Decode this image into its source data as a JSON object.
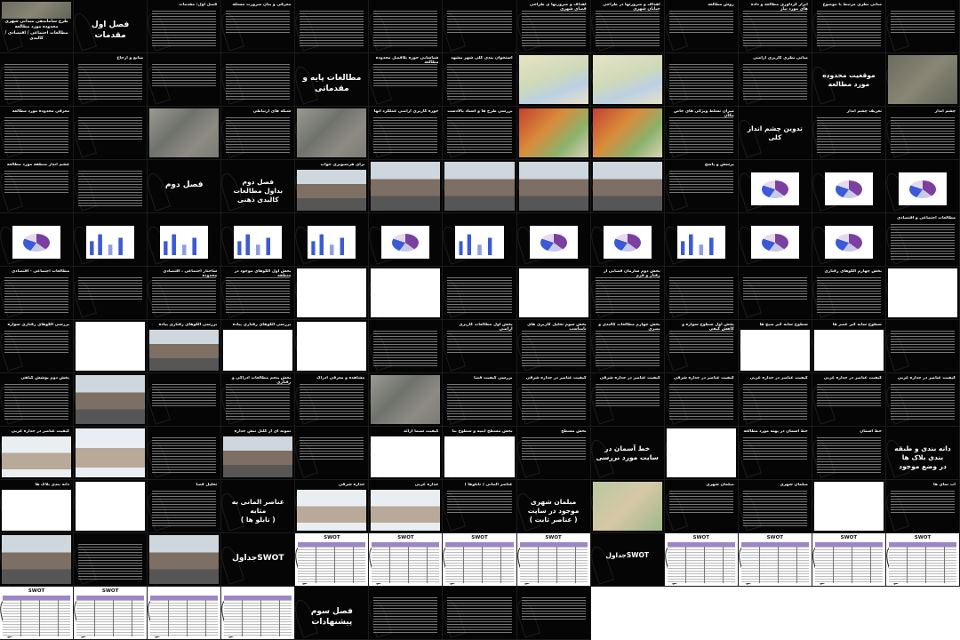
{
  "slides": [
    {
      "kind": "title-photo",
      "title": "طرح ساماندهی مبدانی شهری\nمحدوده مورد مطالعه\nمطالعات اجتماعی / اقتصادی / کالبدی"
    },
    {
      "kind": "big",
      "text": "فصل اول\nمقدمات"
    },
    {
      "kind": "text",
      "title": "فصل اول: مقدمات"
    },
    {
      "kind": "text",
      "title": "معرفی و بیان ضرورت مسئله"
    },
    {
      "kind": "text",
      "title": ""
    },
    {
      "kind": "text",
      "title": ""
    },
    {
      "kind": "text",
      "title": ""
    },
    {
      "kind": "text",
      "title": "اهداف و ضرورتها ی طراحی فضای شهری"
    },
    {
      "kind": "text",
      "title": "اهداف و ضرورتها در طراحی خیابان شهری"
    },
    {
      "kind": "text",
      "title": "روش مطالعه"
    },
    {
      "kind": "text",
      "title": "ابزار گردآوری مطالعه و داده های مورد نیاز"
    },
    {
      "kind": "text",
      "title": "مبانی نظری مرتبط با موضوع"
    },
    {
      "kind": "text",
      "title": ""
    },
    {
      "kind": "text",
      "title": ""
    },
    {
      "kind": "text",
      "title": "منابع و ارجاع"
    },
    {
      "kind": "text",
      "title": ""
    },
    {
      "kind": "text",
      "title": ""
    },
    {
      "kind": "big",
      "text": "مطالعات پایه و مقدماتی"
    },
    {
      "kind": "text",
      "title": "شناسایی حوزه بلافصل محدوده مطالعه"
    },
    {
      "kind": "text",
      "title": "استخوان بندی کلی شهر مشهد"
    },
    {
      "kind": "img",
      "img": "map2",
      "title": ""
    },
    {
      "kind": "img",
      "img": "map2",
      "title": ""
    },
    {
      "kind": "text",
      "title": ""
    },
    {
      "kind": "text",
      "title": "مبانی نظری کاربری اراضی"
    },
    {
      "kind": "big",
      "text": "موقعیت محدوده مورد مطالعه"
    },
    {
      "kind": "img",
      "img": "aerial",
      "title": ""
    },
    {
      "kind": "text",
      "title": "معرفی محدوده مورد مطالعه"
    },
    {
      "kind": "text",
      "title": ""
    },
    {
      "kind": "img",
      "img": "map",
      "title": ""
    },
    {
      "kind": "text",
      "title": "شبکه های ارتباطی"
    },
    {
      "kind": "img",
      "img": "map",
      "title": ""
    },
    {
      "kind": "text",
      "title": "حوزه کاربری اراضی عملکرد آنها"
    },
    {
      "kind": "text",
      "title": "بررسی طرح ها و اسناد بالادست"
    },
    {
      "kind": "img",
      "img": "red",
      "title": ""
    },
    {
      "kind": "img",
      "img": "red",
      "title": ""
    },
    {
      "kind": "text",
      "title": "میزان تسلط ویژگی های خاص مکان"
    },
    {
      "kind": "big",
      "text": "تدوین چشم انداز کلی"
    },
    {
      "kind": "text",
      "title": "تعریف چشم انداز"
    },
    {
      "kind": "text",
      "title": "چشم انداز"
    },
    {
      "kind": "text",
      "title": "چشم انداز منطقه مورد مطالعه"
    },
    {
      "kind": "text",
      "title": ""
    },
    {
      "kind": "big",
      "text": "فصل دوم"
    },
    {
      "kind": "big",
      "text": "فصل دوم\nبداول مطالعات کالبدی ذهنی"
    },
    {
      "kind": "img",
      "img": "street",
      "title": "برای هرتصویری جواب"
    },
    {
      "kind": "img",
      "img": "street",
      "title": ""
    },
    {
      "kind": "img",
      "img": "street",
      "title": ""
    },
    {
      "kind": "img",
      "img": "street",
      "title": ""
    },
    {
      "kind": "img",
      "img": "street",
      "title": ""
    },
    {
      "kind": "text",
      "title": "پرسش و پاسخ"
    },
    {
      "kind": "chart",
      "chart": "pie",
      "title": ""
    },
    {
      "kind": "chart",
      "chart": "pie",
      "title": ""
    },
    {
      "kind": "chart",
      "chart": "pie",
      "title": ""
    },
    {
      "kind": "chart",
      "chart": "pie",
      "title": ""
    },
    {
      "kind": "chart",
      "chart": "bar",
      "title": ""
    },
    {
      "kind": "chart",
      "chart": "bar",
      "title": ""
    },
    {
      "kind": "chart",
      "chart": "bar",
      "title": ""
    },
    {
      "kind": "chart",
      "chart": "bar",
      "title": ""
    },
    {
      "kind": "chart",
      "chart": "pie",
      "title": ""
    },
    {
      "kind": "chart",
      "chart": "bar",
      "title": ""
    },
    {
      "kind": "chart",
      "chart": "pie",
      "title": ""
    },
    {
      "kind": "chart",
      "chart": "pie",
      "title": ""
    },
    {
      "kind": "chart",
      "chart": "bar",
      "title": ""
    },
    {
      "kind": "chart",
      "chart": "pie",
      "title": ""
    },
    {
      "kind": "chart",
      "chart": "pie",
      "title": ""
    },
    {
      "kind": "text",
      "title": "مطالعات اجتماعی و اقتصادی"
    },
    {
      "kind": "text",
      "title": "مطالعات اجتماعی - اقتصادی"
    },
    {
      "kind": "text",
      "title": ""
    },
    {
      "kind": "text",
      "title": "ساختار اجتماعی ، اقتصادی محدوده"
    },
    {
      "kind": "text",
      "title": "بخش اول الگوهای موجود در منطقه"
    },
    {
      "kind": "img",
      "img": "plan",
      "title": ""
    },
    {
      "kind": "img",
      "img": "plan",
      "title": ""
    },
    {
      "kind": "text",
      "title": ""
    },
    {
      "kind": "img",
      "img": "plan",
      "title": ""
    },
    {
      "kind": "text",
      "title": "بخش دوم سازمان فضایی از رفتار و فرم"
    },
    {
      "kind": "text",
      "title": ""
    },
    {
      "kind": "text",
      "title": ""
    },
    {
      "kind": "text",
      "title": "بخش چهارم الگوهای رفتاری"
    },
    {
      "kind": "img",
      "img": "plan",
      "title": ""
    },
    {
      "kind": "text",
      "title": "بررسی الگوهای رفتاری سواره"
    },
    {
      "kind": "img",
      "img": "plan",
      "title": ""
    },
    {
      "kind": "img",
      "img": "street",
      "title": "بررسی الگوهای رفتاری پیاده"
    },
    {
      "kind": "img",
      "img": "plan",
      "title": "بررسی الگوهای رفتاری پیاده"
    },
    {
      "kind": "img",
      "img": "plan",
      "title": ""
    },
    {
      "kind": "text",
      "title": ""
    },
    {
      "kind": "text",
      "title": "بخش اول مطالعات کاربری اراضی"
    },
    {
      "kind": "text",
      "title": "بخش سوم تحلیل کاربری های نامناسب"
    },
    {
      "kind": "text",
      "title": "بخش چهارم مطالعات کالبدی و بصری"
    },
    {
      "kind": "text",
      "title": "بخش اول سطوح سواره و کاهش کیفی"
    },
    {
      "kind": "img",
      "img": "plan",
      "title": "سطوح سایه گیر صبح ها"
    },
    {
      "kind": "img",
      "img": "plan",
      "title": "سطوح سایه گیر عصر ها"
    },
    {
      "kind": "text",
      "title": ""
    },
    {
      "kind": "text",
      "title": "بخش دوم پوشش گیاهی"
    },
    {
      "kind": "img",
      "img": "street",
      "title": ""
    },
    {
      "kind": "text",
      "title": ""
    },
    {
      "kind": "text",
      "title": "بخش پنجم مطالعات ادراکی و رفتاری"
    },
    {
      "kind": "text",
      "title": "مشاهده و معرفی ادراک"
    },
    {
      "kind": "img",
      "img": "map",
      "title": ""
    },
    {
      "kind": "text",
      "title": "بررسی کیفیت فضا"
    },
    {
      "kind": "text",
      "title": "کیفیت عناصر در جداره شرقی"
    },
    {
      "kind": "text",
      "title": "کیفیت عناصر در جداره شرقی"
    },
    {
      "kind": "text",
      "title": "کیفیت عناصر در جداره شرقی"
    },
    {
      "kind": "text",
      "title": "کیفیت عناصر در جداره غربی"
    },
    {
      "kind": "text",
      "title": "کیفیت عناصر در جداره غربی"
    },
    {
      "kind": "text",
      "title": "کیفیت عناصر در جداره غربی"
    },
    {
      "kind": "img",
      "img": "elev",
      "title": "کیفیت عناصر در جداره غربی"
    },
    {
      "kind": "img",
      "img": "elev",
      "title": ""
    },
    {
      "kind": "text",
      "title": ""
    },
    {
      "kind": "img",
      "img": "street",
      "title": "نمونه ای از کلنل نبش جداره"
    },
    {
      "kind": "text",
      "title": ""
    },
    {
      "kind": "img",
      "img": "plan",
      "title": "کیفیت سیما ارائه"
    },
    {
      "kind": "img",
      "img": "plan",
      "title": "بخش مسطح ابنیه و سطوح بنا"
    },
    {
      "kind": "text",
      "title": "بخش مسطح"
    },
    {
      "kind": "big",
      "text": "خط آسمان در سایت مورد بررسی"
    },
    {
      "kind": "img",
      "img": "plan",
      "title": ""
    },
    {
      "kind": "text",
      "title": "خط آسمان در پهنه مورد مطالعه"
    },
    {
      "kind": "text",
      "title": "خط آسمان"
    },
    {
      "kind": "big",
      "text": "دانه بندی و طبقه بندی بلاک ها\nدر وضع موجود"
    },
    {
      "kind": "img",
      "img": "plan",
      "title": "دانه بندی بلاک ها"
    },
    {
      "kind": "img",
      "img": "plan",
      "title": ""
    },
    {
      "kind": "text",
      "title": "تحلیل فضا"
    },
    {
      "kind": "big",
      "text": "عناصر المانی به مثابه\n( تابلو ها )"
    },
    {
      "kind": "img",
      "img": "elev",
      "title": "جداره شرقی"
    },
    {
      "kind": "img",
      "img": "elev",
      "title": "جداره غربی"
    },
    {
      "kind": "text",
      "title": "عناصر المانی ( تابلوها )"
    },
    {
      "kind": "big",
      "text": "مبلمان شهری موجود در سایت\n( عناصر ثابت )"
    },
    {
      "kind": "img",
      "img": "green",
      "title": ""
    },
    {
      "kind": "text",
      "title": "مبلمان شهری"
    },
    {
      "kind": "text",
      "title": "مبلمان شهری"
    },
    {
      "kind": "img",
      "img": "plan",
      "title": ""
    },
    {
      "kind": "text",
      "title": "اب نمای ها"
    },
    {
      "kind": "img",
      "img": "street",
      "title": ""
    },
    {
      "kind": "text",
      "title": ""
    },
    {
      "kind": "img",
      "img": "street",
      "title": ""
    },
    {
      "kind": "big",
      "text": "SWOTجداول"
    },
    {
      "kind": "swot",
      "title": "SWOT"
    },
    {
      "kind": "swot",
      "title": "SWOT"
    },
    {
      "kind": "swot",
      "title": "SWOT"
    },
    {
      "kind": "swot",
      "title": "SWOT"
    },
    {
      "kind": "big",
      "text": "SWOTجداول"
    },
    {
      "kind": "swot",
      "title": "SWOT"
    },
    {
      "kind": "swot",
      "title": "SWOT"
    },
    {
      "kind": "swot",
      "title": "SWOT"
    },
    {
      "kind": "swot",
      "title": "SWOT"
    },
    {
      "kind": "swot",
      "title": "SWOT"
    },
    {
      "kind": "swot",
      "title": "SWOT"
    },
    {
      "kind": "swot",
      "title": ""
    },
    {
      "kind": "swot",
      "title": ""
    },
    {
      "kind": "big",
      "text": "فصل سوم\nپیشنهادات"
    },
    {
      "kind": "text",
      "title": ""
    },
    {
      "kind": "text",
      "title": ""
    },
    {
      "kind": "text",
      "title": ""
    },
    {
      "kind": "blank",
      "title": ""
    },
    {
      "kind": "blank",
      "title": ""
    },
    {
      "kind": "blank",
      "title": ""
    },
    {
      "kind": "blank",
      "title": ""
    },
    {
      "kind": "blank",
      "title": ""
    }
  ]
}
